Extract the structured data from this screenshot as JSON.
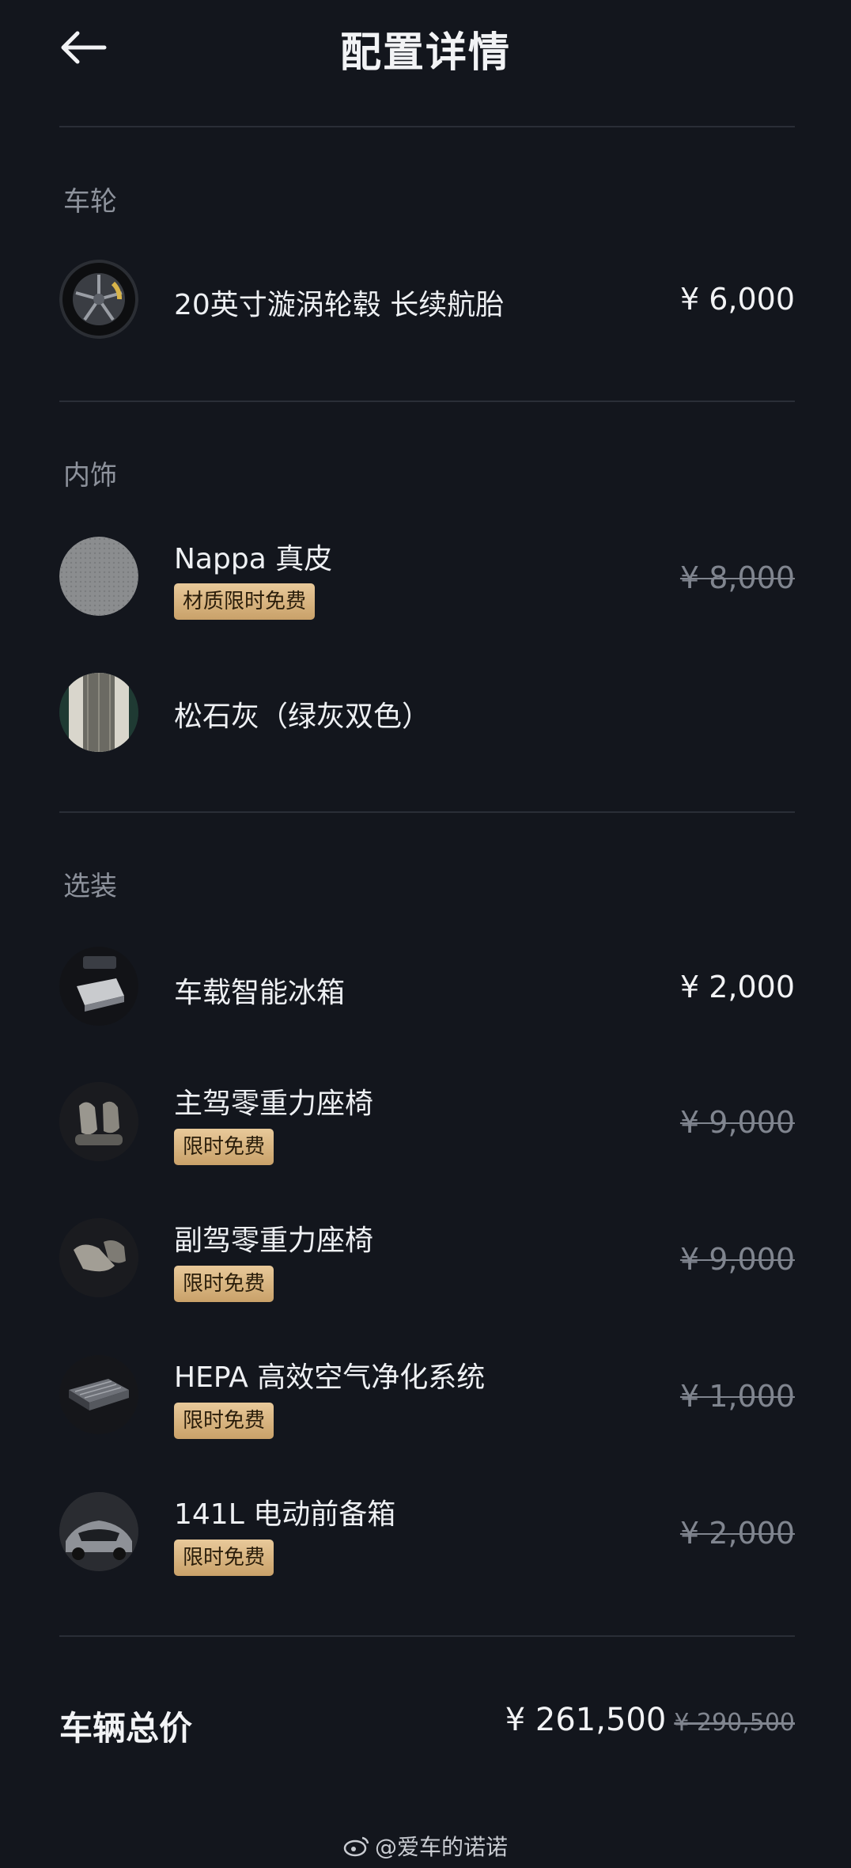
{
  "header": {
    "title": "配置详情",
    "back_icon": "back-arrow-icon"
  },
  "sections": {
    "wheels": {
      "label": "车轮",
      "item": {
        "name": "20英寸漩涡轮毂 长续航胎",
        "price": "¥ 6,000"
      }
    },
    "interior": {
      "label": "内饰",
      "items": [
        {
          "name": "Nappa 真皮",
          "badge": "材质限时免费",
          "price": "¥ 8,000"
        },
        {
          "name": "松石灰（绿灰双色）"
        }
      ]
    },
    "options": {
      "label": "选装",
      "items": [
        {
          "name": "车载智能冰箱",
          "price": "¥ 2,000"
        },
        {
          "name": "主驾零重力座椅",
          "badge": "限时免费",
          "price": "¥ 9,000"
        },
        {
          "name": "副驾零重力座椅",
          "badge": "限时免费",
          "price": "¥ 9,000"
        },
        {
          "name": "HEPA 高效空气净化系统",
          "badge": "限时免费",
          "price": "¥ 1,000"
        },
        {
          "name": "141L 电动前备箱",
          "badge": "限时免费",
          "price": "¥ 2,000"
        }
      ]
    }
  },
  "total": {
    "label": "车辆总价",
    "price": "¥ 261,500",
    "original_price": "¥ 290,500"
  },
  "watermark": {
    "text": "@爱车的诺诺",
    "icon": "weibo-icon"
  },
  "colors": {
    "background": "#13161d",
    "badge_gold": "#d6b27e",
    "muted_text": "#80858f"
  }
}
